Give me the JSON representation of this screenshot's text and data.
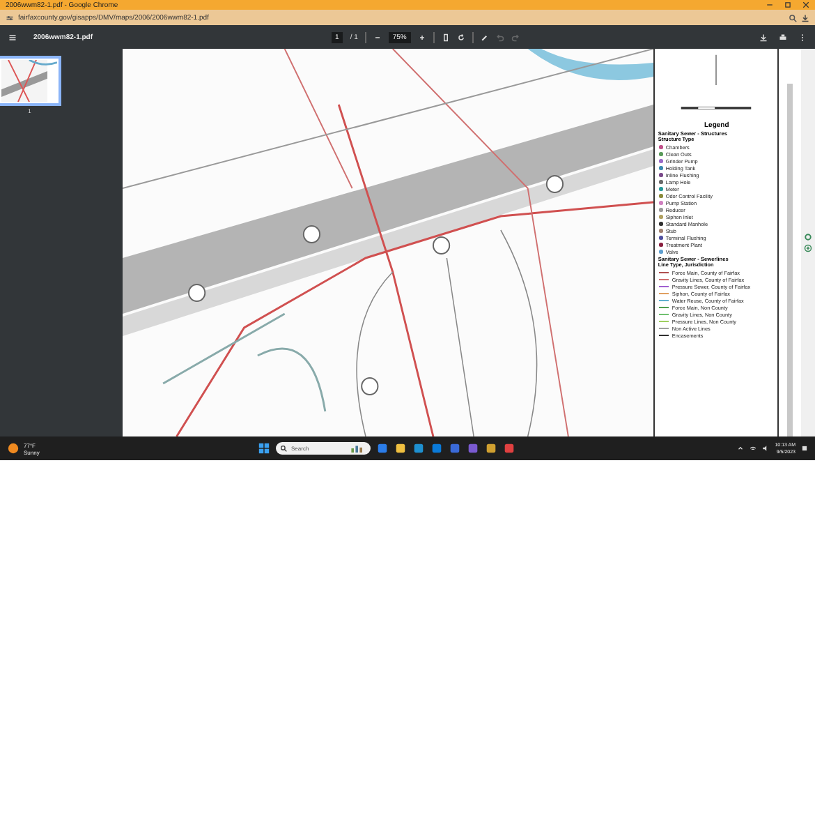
{
  "window": {
    "title": "2006wwm82-1.pdf - Google Chrome"
  },
  "address_bar": {
    "url": "fairfaxcounty.gov/gisapps/DMV/maps/2006/2006wwm82-1.pdf"
  },
  "pdf_toolbar": {
    "file_name": "2006wwm82-1.pdf",
    "page": "1",
    "page_count": "/ 1",
    "zoom": "75%"
  },
  "sidebar": {
    "thumbnails": [
      {
        "label": "1",
        "selected": true
      }
    ]
  },
  "page": {
    "legend": {
      "title": "Legend",
      "structures_heading": "Sanitary Sewer - Structures",
      "structures_subheading": "Structure Type",
      "structures": [
        {
          "label": "Chambers",
          "color": "#c0508a"
        },
        {
          "label": "Clean Outs",
          "color": "#5a9a5a"
        },
        {
          "label": "Grinder Pump",
          "color": "#9a6ac8"
        },
        {
          "label": "Holding Tank",
          "color": "#3a8ab0"
        },
        {
          "label": "Inline Flushing",
          "color": "#7a4a8a"
        },
        {
          "label": "Lamp Hole",
          "color": "#6a6a6a"
        },
        {
          "label": "Meter",
          "color": "#2a9a9a"
        },
        {
          "label": "Odor Control Facility",
          "color": "#8a8a3a"
        },
        {
          "label": "Pump Station",
          "color": "#d080c0"
        },
        {
          "label": "Reducer",
          "color": "#9a9a9a"
        },
        {
          "label": "Siphon Inlet",
          "color": "#b0a060"
        },
        {
          "label": "Standard Manhole",
          "color": "#303030"
        },
        {
          "label": "Stub",
          "color": "#a08070"
        },
        {
          "label": "Terminal Flushing",
          "color": "#5050a0"
        },
        {
          "label": "Treatment Plant",
          "color": "#8a2040"
        },
        {
          "label": "Valve",
          "color": "#60a0d0"
        }
      ],
      "sewerlines_heading": "Sanitary Sewer - Sewerlines",
      "sewerlines_subheading": "Line Type, Jurisdiction",
      "sewerlines": [
        {
          "label": "Force Main, County of Fairfax",
          "color": "#b05050"
        },
        {
          "label": "Gravity Lines, County of Fairfax",
          "color": "#d07070"
        },
        {
          "label": "Pressure Sewer, County of Fairfax",
          "color": "#a060d0"
        },
        {
          "label": "Siphon, County of Fairfax",
          "color": "#e0a060"
        },
        {
          "label": "Water Reuse, County of Fairfax",
          "color": "#60b0d0"
        },
        {
          "label": "Force Main, Non County",
          "color": "#50a050"
        },
        {
          "label": "Gravity Lines, Non County",
          "color": "#70c070"
        },
        {
          "label": "Pressure Lines, Non County",
          "color": "#a0d060"
        },
        {
          "label": "Non Active Lines",
          "color": "#a0a0a0"
        },
        {
          "label": "Encasements",
          "color": "#303030"
        }
      ]
    }
  },
  "taskbar": {
    "weather_temp": "77°F",
    "weather_text": "Sunny",
    "search_placeholder": "Search",
    "time": "10:13 AM",
    "date": "9/5/2023"
  }
}
